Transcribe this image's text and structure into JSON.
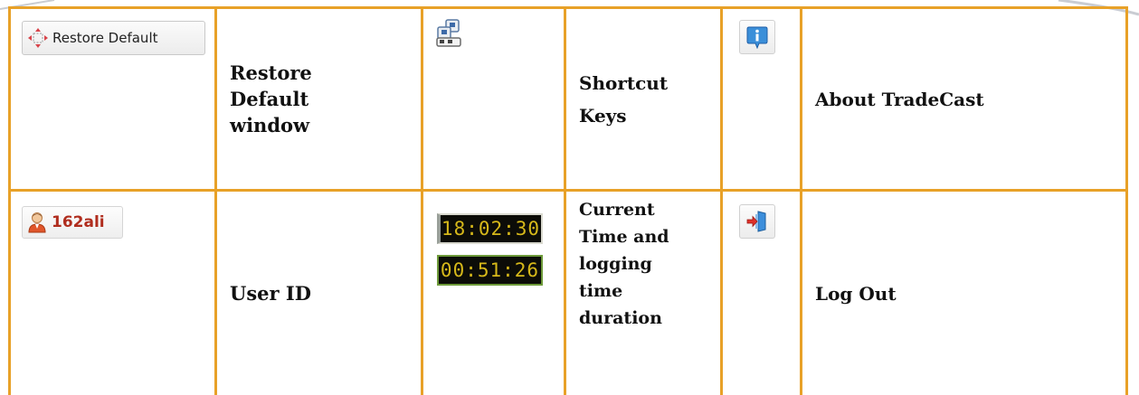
{
  "rows": [
    {
      "restore_button_label": "Restore Default",
      "restore_desc": [
        "Restore",
        "Default",
        "window"
      ],
      "shortcut_desc": [
        "Shortcut",
        "Keys"
      ],
      "about_desc": "About TradeCast"
    },
    {
      "user_label": "162ali",
      "user_desc": "User ID",
      "clock_current": "18:02:30",
      "clock_duration": "00:51:26",
      "time_desc": [
        "Current",
        "Time and",
        "logging",
        "time",
        "duration"
      ],
      "logout_desc": "Log Out"
    }
  ],
  "colors": {
    "border": "#e8a128",
    "clock_digits": "#d6b81a",
    "user_text": "#b02d1e"
  },
  "icons": [
    "restore-icon",
    "shortcut-keys-icon",
    "info-icon",
    "user-icon",
    "logout-icon"
  ]
}
